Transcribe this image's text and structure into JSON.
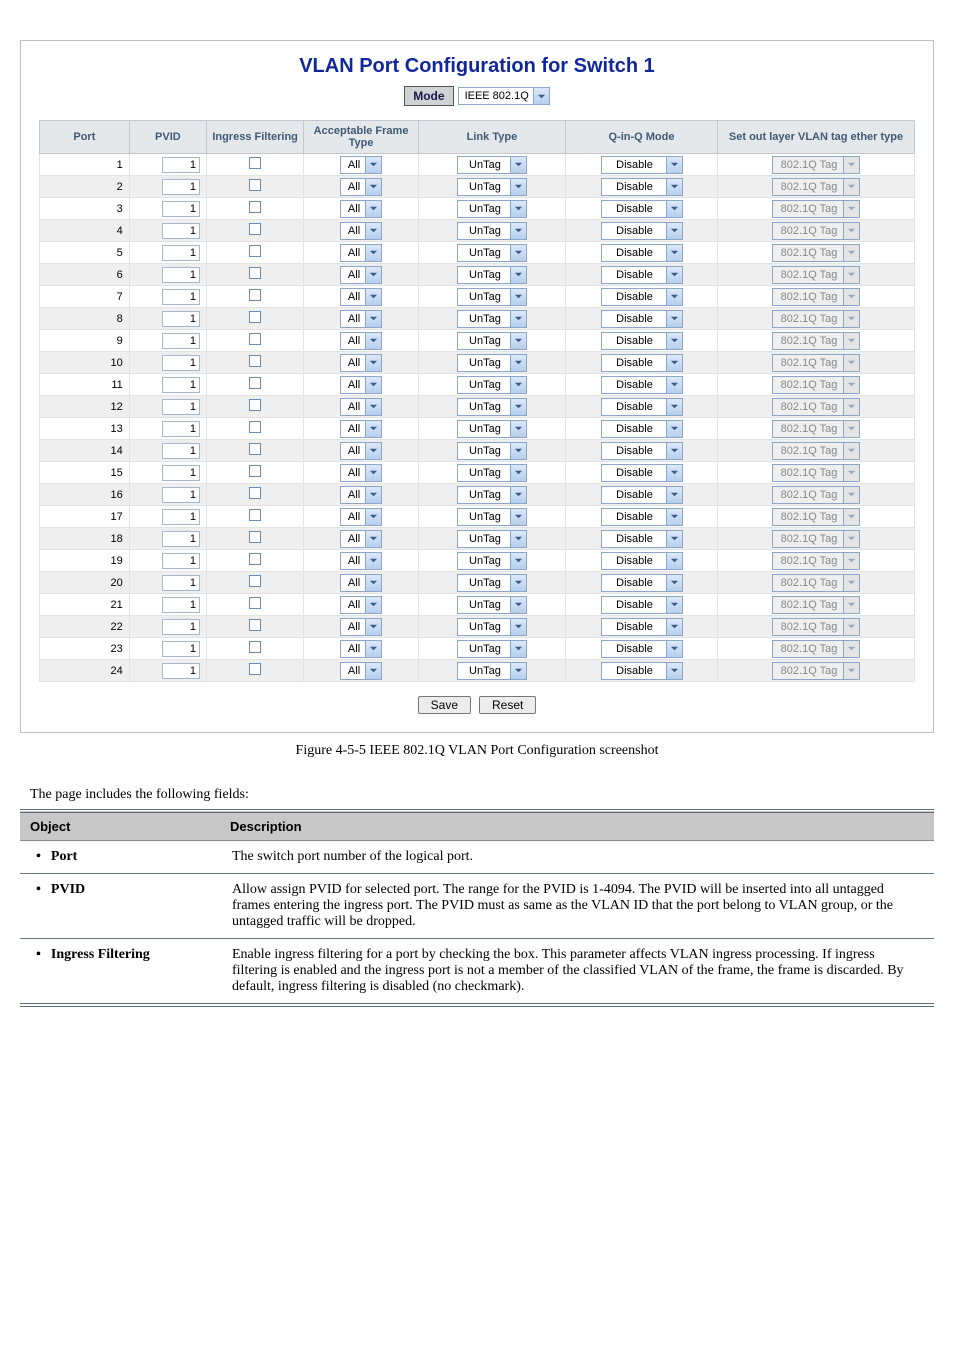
{
  "figure": {
    "title": "VLAN Port Configuration for Switch 1",
    "mode_label": "Mode",
    "mode_value": "IEEE 802.1Q",
    "headers": {
      "port": "Port",
      "pvid": "PVID",
      "ingress": "Ingress Filtering",
      "acceptable": "Acceptable Frame Type",
      "linktype": "Link Type",
      "qinq": "Q-in-Q Mode",
      "outlayer": "Set out layer VLAN tag ether type"
    },
    "row_defaults": {
      "pvid": "1",
      "acceptable": "All",
      "linktype": "UnTag",
      "qinq": "Disable",
      "outlayer": "802.1Q Tag"
    },
    "port_count": 24,
    "buttons": {
      "save": "Save",
      "reset": "Reset"
    }
  },
  "caption": "Figure 4-5-5 IEEE 802.1Q VLAN Port Configuration screenshot",
  "desc_intro": "The page includes the following fields:",
  "desc_table": {
    "head_obj": "Object",
    "head_desc": "Description",
    "rows": [
      {
        "obj": "Port",
        "desc": "The switch port number of the logical port."
      },
      {
        "obj": "PVID",
        "desc": "Allow assign PVID for selected port. The range for the PVID is 1-4094.\nThe PVID will be inserted into all untagged frames entering the ingress port. The PVID must as same as the VLAN ID that the port belong to VLAN group, or the untagged traffic will be dropped."
      },
      {
        "obj": "Ingress Filtering",
        "desc": "Enable ingress filtering for a port by checking the box. This parameter affects VLAN ingress processing. If ingress filtering is enabled and the ingress port is not a member of the classified VLAN of the frame, the frame is discarded. By default, ingress filtering is disabled (no checkmark)."
      }
    ]
  }
}
